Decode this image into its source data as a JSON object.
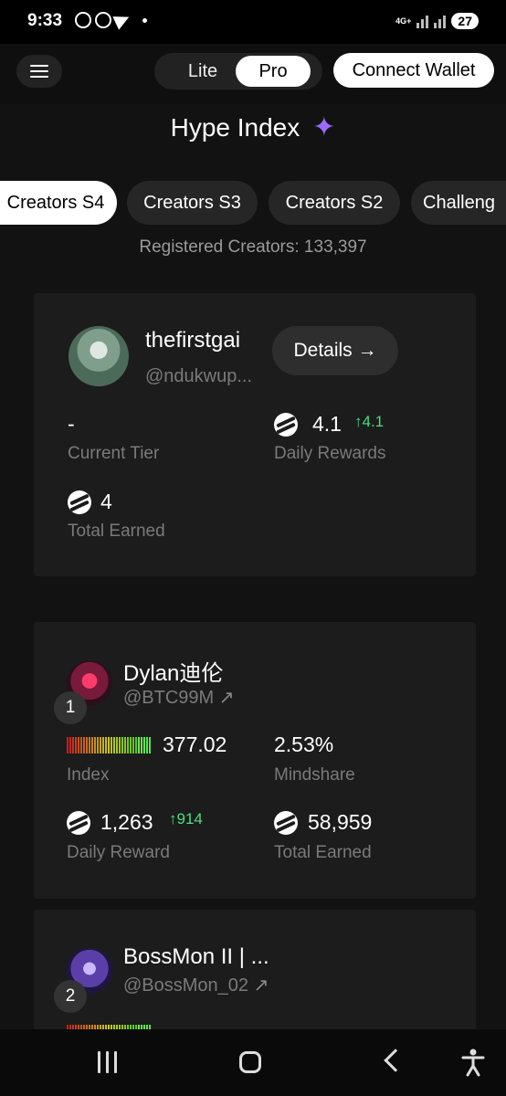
{
  "status_bar": {
    "time": "9:33",
    "network": "4G+",
    "battery": "27",
    "icons": [
      "whatsapp-icon",
      "whatsapp-business-icon",
      "telegram-icon",
      "dot-icon",
      "signal-icon",
      "battery-icon"
    ]
  },
  "header": {
    "menu_icon": "hamburger-menu-icon",
    "mode_lite": "Lite",
    "mode_pro": "Pro",
    "active_mode": "Pro",
    "connect_wallet": "Connect Wallet"
  },
  "page": {
    "title": "Hype Index",
    "title_icon": "sparkles-icon",
    "tabs": [
      {
        "label": "Creators S4",
        "active": true
      },
      {
        "label": "Creators S3",
        "active": false
      },
      {
        "label": "Creators S2",
        "active": false
      },
      {
        "label": "Challeng",
        "active": false
      }
    ],
    "registered_creators": "Registered Creators: 133,397"
  },
  "my_card": {
    "name": "thefirstgai",
    "handle": "@ndukwup...",
    "details_label": "Details →",
    "current_tier_value": "-",
    "current_tier_label": "Current Tier",
    "daily_rewards_value": "4.1",
    "daily_rewards_change": "↑4.1",
    "daily_rewards_label": "Daily Rewards",
    "total_earned_value": "4",
    "total_earned_label": "Total Earned"
  },
  "leaderboard": [
    {
      "rank": "1",
      "name": "Dylan迪伦",
      "handle": "@BTC99M",
      "index_value": "377.02",
      "index_label": "Index",
      "mindshare_value": "2.53%",
      "mindshare_label": "Mindshare",
      "daily_reward_value": "1,263",
      "daily_reward_change": "↑914",
      "daily_reward_label": "Daily Reward",
      "total_earned_value": "58,959",
      "total_earned_label": "Total Earned"
    },
    {
      "rank": "2",
      "name": "BossMon II | ...",
      "handle": "@BossMon_02"
    }
  ],
  "colors": {
    "background": "#121212",
    "card": "#1c1c1c",
    "accent_sparkle": "#9b6bff",
    "positive": "#4ade80",
    "muted_text": "#7a7a7a"
  },
  "nav_bar": {
    "icons": [
      "recent-apps-icon",
      "home-icon",
      "back-icon",
      "accessibility-icon"
    ]
  }
}
